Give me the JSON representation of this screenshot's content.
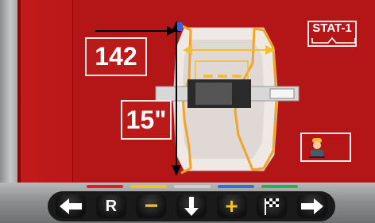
{
  "measurements": {
    "distance_value": "142",
    "diameter_value": "15\""
  },
  "status": {
    "stat_label": "STAT-1"
  },
  "operator": {
    "icon": "operator-icon"
  },
  "color_tabs": [
    "#e02020",
    "#f0c419",
    "#cfcfcf",
    "#2f6fe0",
    "#25b24a"
  ],
  "keys": [
    {
      "name": "arrow-left-key",
      "icon": "arrow-left-icon",
      "label": ""
    },
    {
      "name": "r-key",
      "icon": "",
      "label": "R"
    },
    {
      "name": "minus-key",
      "icon": "minus-icon",
      "label": "−"
    },
    {
      "name": "arrow-down-key",
      "icon": "arrow-down-icon",
      "label": ""
    },
    {
      "name": "plus-key",
      "icon": "plus-icon",
      "label": "+"
    },
    {
      "name": "flag-key",
      "icon": "checkered-flag-icon",
      "label": ""
    },
    {
      "name": "arrow-right-key",
      "icon": "arrow-right-icon",
      "label": ""
    }
  ],
  "colors": {
    "background_red": "#b41617",
    "rim_orange": "#f0a52a",
    "rim_yellow_bar": "#f2c02b"
  }
}
